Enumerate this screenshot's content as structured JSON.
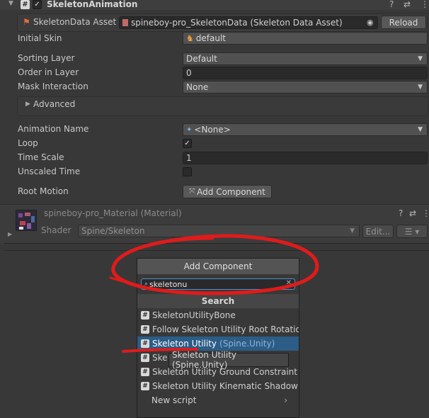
{
  "component": {
    "title": "SkeletonAnimation",
    "help_icon": "?",
    "settings_icon": "⇄",
    "more_icon": "⋮"
  },
  "skeleton_data": {
    "label": "SkeletonData Asset",
    "value": "spineboy-pro_SkeletonData (Skeleton Data Asset)",
    "reload_label": "Reload"
  },
  "fields": {
    "initial_skin_label": "Initial Skin",
    "initial_skin_value": "default",
    "sorting_layer_label": "Sorting Layer",
    "sorting_layer_value": "Default",
    "order_in_layer_label": "Order in Layer",
    "order_in_layer_value": "0",
    "mask_interaction_label": "Mask Interaction",
    "mask_interaction_value": "None",
    "advanced_label": "Advanced",
    "animation_name_label": "Animation Name",
    "animation_name_value": "<None>",
    "loop_label": "Loop",
    "time_scale_label": "Time Scale",
    "time_scale_value": "1",
    "unscaled_time_label": "Unscaled Time",
    "root_motion_label": "Root Motion",
    "add_component_label": "Add Component"
  },
  "material": {
    "name": "spineboy-pro_Material (Material)",
    "shader_label": "Shader",
    "shader_value": "Spine/Skeleton",
    "edit_label": "Edit..."
  },
  "popup": {
    "title": "Add Component",
    "search_value": "skeletonu",
    "section": "Search",
    "items": [
      {
        "label": "SkeletonUtilityBone",
        "sub": ""
      },
      {
        "label": "Follow Skeleton Utility Root Rotatio...",
        "sub": ""
      },
      {
        "label": "Skeleton Utility",
        "sub": "(Spine.Unity)"
      },
      {
        "label": "Ske",
        "sub": ""
      },
      {
        "label": "Skeleton Utility Ground Constraint ...",
        "sub": ""
      },
      {
        "label": "Skeleton Utility Kinematic Shadow ...",
        "sub": ""
      }
    ],
    "new_script": "New script",
    "tooltip": "Skeleton Utility (Spine.Unity)"
  },
  "colors": {
    "accent": "#2c5d87",
    "annotation": "#e01b1b"
  }
}
